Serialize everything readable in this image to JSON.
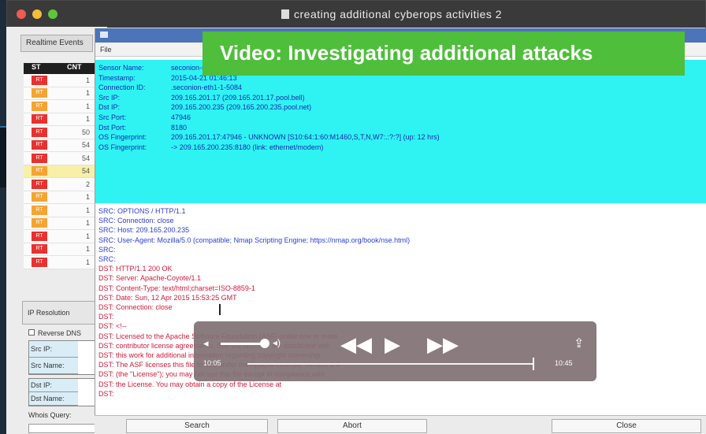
{
  "window": {
    "title": "creating additional cyberops activities 2"
  },
  "left_panel": {
    "tab_label": "Realtime Events",
    "columns": [
      "ST",
      "CNT"
    ],
    "rows": [
      {
        "st": "RT",
        "color": "#e8322f",
        "count": "1"
      },
      {
        "st": "RT",
        "color": "#f5a431",
        "count": "1"
      },
      {
        "st": "RT",
        "color": "#f5a431",
        "count": "1"
      },
      {
        "st": "RT",
        "color": "#e8322f",
        "count": "1"
      },
      {
        "st": "RT",
        "color": "#e8322f",
        "count": "50"
      },
      {
        "st": "RT",
        "color": "#e8322f",
        "count": "54"
      },
      {
        "st": "RT",
        "color": "#e8322f",
        "count": "54"
      },
      {
        "st": "RT",
        "color": "#f5a431",
        "count": "54",
        "highlight": true
      },
      {
        "st": "RT",
        "color": "#e8322f",
        "count": "2"
      },
      {
        "st": "RT",
        "color": "#f5a431",
        "count": "1"
      },
      {
        "st": "RT",
        "color": "#f5a431",
        "count": "1"
      },
      {
        "st": "RT",
        "color": "#f5a431",
        "count": "1"
      },
      {
        "st": "RT",
        "color": "#e8322f",
        "count": "1"
      },
      {
        "st": "RT",
        "color": "#e8322f",
        "count": "1"
      },
      {
        "st": "RT",
        "color": "#e8322f",
        "count": "1"
      }
    ],
    "ip_resolution": "IP Resolution",
    "reverse_dns": "Reverse DNS",
    "src_ip": "Src IP:",
    "src_name": "Src Name:",
    "dst_ip": "Dst IP:",
    "dst_name": "Dst Name:",
    "whois_query": "Whois Query:"
  },
  "child_window": {
    "menu": "File"
  },
  "banner": "Video: Investigating additional attacks",
  "session_info": [
    {
      "k": "Sensor Name:",
      "v": "seconion-server-eth1"
    },
    {
      "k": "Timestamp:",
      "v": "2015-04-21 01:46:13"
    },
    {
      "k": "Connection ID:",
      "v": ".seconion-eth1-1-5084"
    },
    {
      "k": "Src IP:",
      "v": "209.165.201.17 (209.165.201.17.pool.bell)"
    },
    {
      "k": "Dst IP:",
      "v": "209.165.200.235 (209.165.200.235.pool.net)"
    },
    {
      "k": "Src Port:",
      "v": "47946"
    },
    {
      "k": "Dst Port:",
      "v": "8180"
    },
    {
      "k": "OS Fingerprint:",
      "v": "209.165.201.17:47946 - UNKNOWN [S10:64:1:60:M1460,S,T,N,W7:.:?:?] (up: 12 hrs)"
    },
    {
      "k": "OS Fingerprint:",
      "v": "-> 209.165.200.235:8180 (link: ethernet/modem)"
    }
  ],
  "transcript": [
    {
      "dir": "src",
      "text": "SRC: OPTIONS / HTTP/1.1"
    },
    {
      "dir": "src",
      "text": "SRC: Connection: close"
    },
    {
      "dir": "src",
      "text": "SRC: Host: 209.165.200.235"
    },
    {
      "dir": "src",
      "text": "SRC: User-Agent: Mozilla/5.0 (compatible; Nmap Scripting Engine; https://nmap.org/book/nse.html)"
    },
    {
      "dir": "src",
      "text": "SRC:"
    },
    {
      "dir": "src",
      "text": "SRC:"
    },
    {
      "dir": "dst",
      "text": "DST: HTTP/1.1 200 OK"
    },
    {
      "dir": "dst",
      "text": "DST: Server: Apache-Coyote/1.1"
    },
    {
      "dir": "dst",
      "text": "DST: Content-Type: text/html;charset=ISO-8859-1"
    },
    {
      "dir": "dst",
      "text": "DST: Date: Sun, 12 Apr 2015 15:53:25 GMT"
    },
    {
      "dir": "dst",
      "text": "DST: Connection: close"
    },
    {
      "dir": "dst",
      "text": "DST:"
    },
    {
      "dir": "dst",
      "text": "DST: <!--"
    },
    {
      "dir": "dst",
      "text": "DST:   Licensed to the Apache Software Foundation (ASF) under one or more"
    },
    {
      "dir": "dst",
      "text": "DST:   contributor license agreements.  See the NOTICE file distributed with"
    },
    {
      "dir": "dst",
      "text": "DST:   this work for additional information regarding copyright ownership."
    },
    {
      "dir": "dst",
      "text": "DST:   The ASF licenses this file to You under the Apache License, Version 2.0"
    },
    {
      "dir": "dst",
      "text": "DST:   (the \"License\"); you may not use this file except in compliance with"
    },
    {
      "dir": "dst",
      "text": "DST:   the License.  You may obtain a copy of the License at"
    },
    {
      "dir": "dst",
      "text": "DST:"
    }
  ],
  "buttons": {
    "search": "Search",
    "abort": "Abort",
    "close": "Close"
  },
  "video": {
    "elapsed": "10:05",
    "remaining": "10:45",
    "progress": 0.99,
    "volume": 0.8
  }
}
